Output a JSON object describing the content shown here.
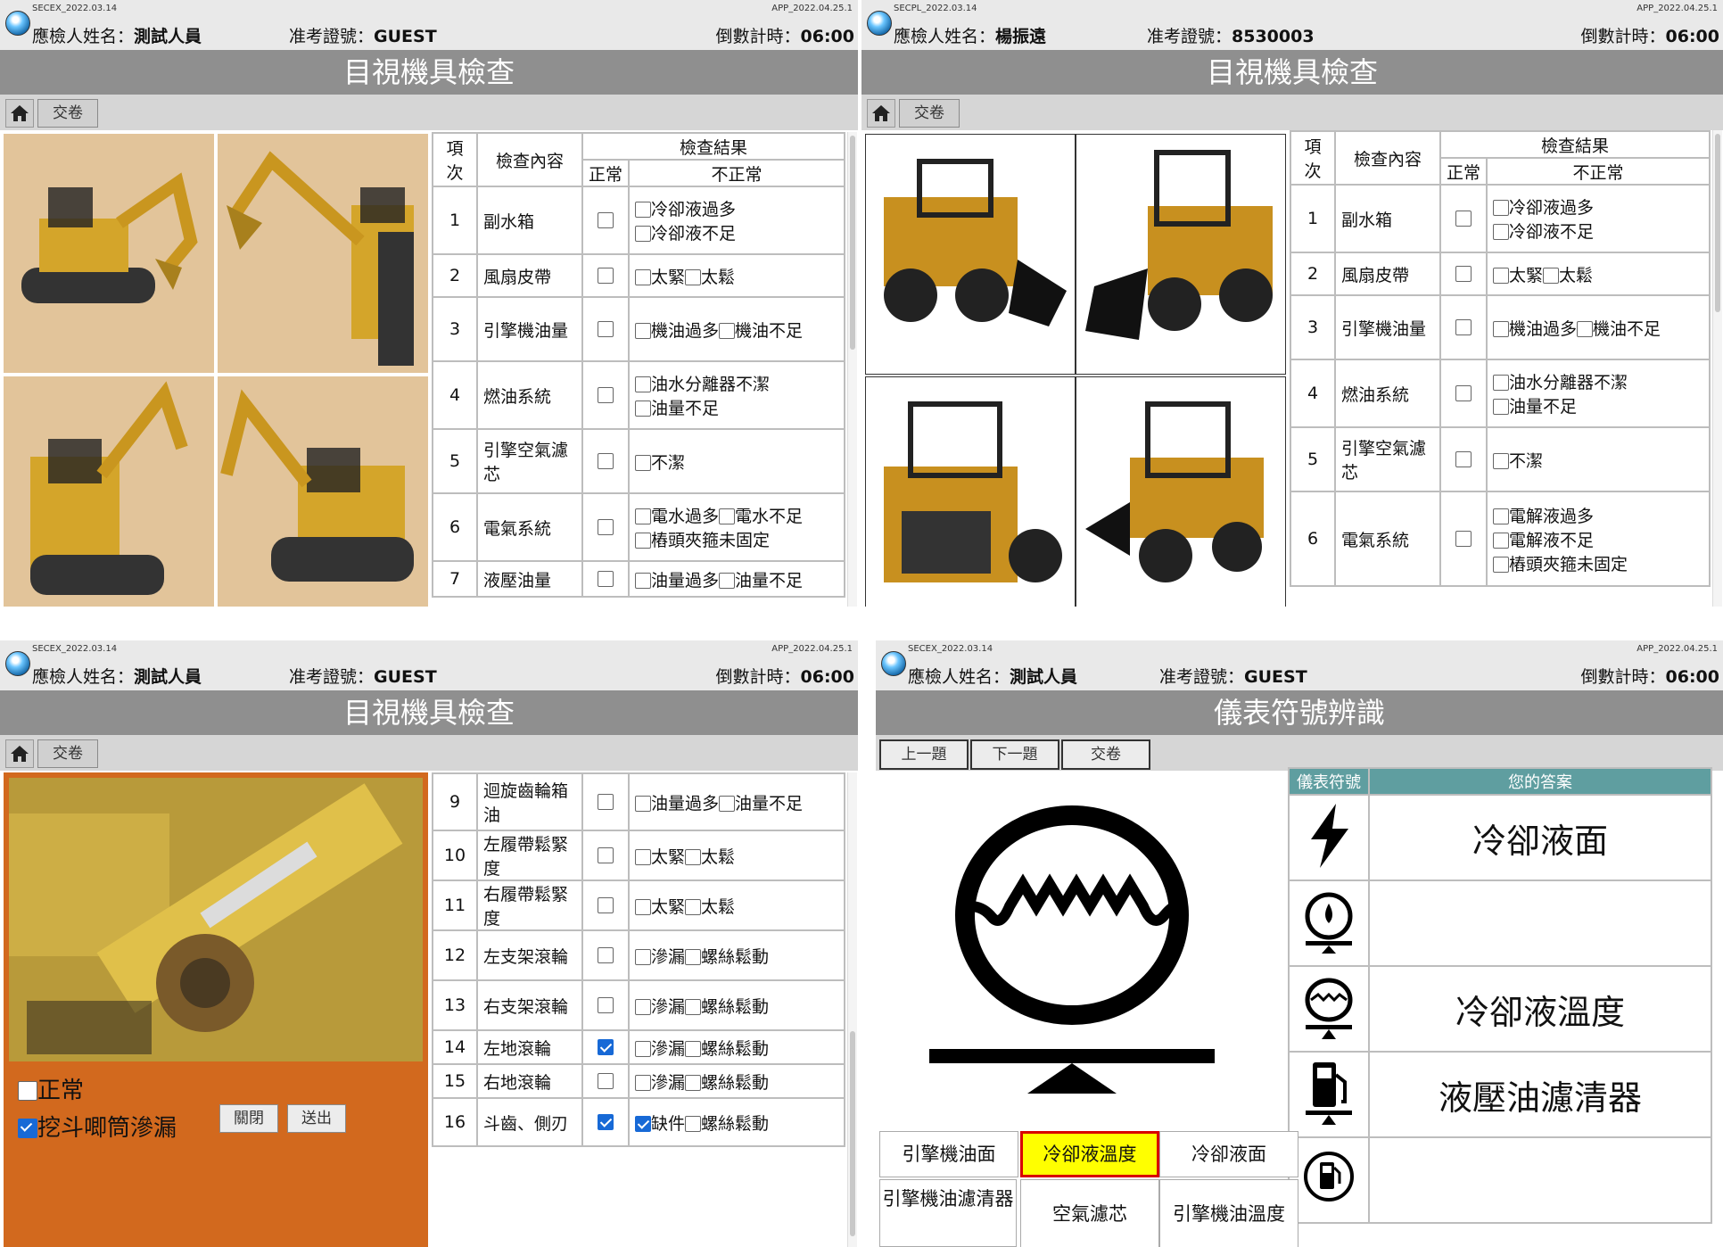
{
  "panels": {
    "excavator": {
      "version_left": "SECEX_2022.03.14",
      "version_right": "APP_2022.04.25.1",
      "name_label": "應檢人姓名：",
      "name_value": "測試人員",
      "id_label": "准考證號：",
      "id_value": "GUEST",
      "timer_label": "倒數計時：",
      "timer_value": "06:00",
      "title": "目視機具檢查",
      "submit_label": "交卷",
      "columns": {
        "no": "項次",
        "content": "檢查內容",
        "result": "檢查結果",
        "normal": "正常",
        "abnormal": "不正常"
      },
      "rows": [
        {
          "no": "1",
          "item": "副水箱",
          "options": [
            "冷卻液過多",
            "冷卻液不足"
          ]
        },
        {
          "no": "2",
          "item": "風扇皮帶",
          "options": [
            "太緊",
            "太鬆"
          ]
        },
        {
          "no": "3",
          "item": "引擎機油量",
          "options": [
            "機油過多",
            "機油不足"
          ]
        },
        {
          "no": "4",
          "item": "燃油系統",
          "options": [
            "油水分離器不潔",
            "油量不足"
          ]
        },
        {
          "no": "5",
          "item": "引擎空氣濾芯",
          "options": [
            "不潔"
          ]
        },
        {
          "no": "6",
          "item": "電氣系統",
          "options": [
            "電水過多",
            "電水不足",
            "樁頭夾箍未固定"
          ]
        },
        {
          "no": "7",
          "item": "液壓油量",
          "options": [
            "油量過多",
            "油量不足"
          ]
        }
      ]
    },
    "loader": {
      "version_left": "SECPL_2022.03.14",
      "version_right": "APP_2022.04.25.1",
      "name_label": "應檢人姓名：",
      "name_value": "楊振遠",
      "id_label": "准考證號：",
      "id_value": "8530003",
      "timer_label": "倒數計時：",
      "timer_value": "06:00",
      "title": "目視機具檢查",
      "submit_label": "交卷",
      "columns": {
        "no": "項次",
        "content": "檢查內容",
        "result": "檢查結果",
        "normal": "正常",
        "abnormal": "不正常"
      },
      "rows": [
        {
          "no": "1",
          "item": "副水箱",
          "options": [
            "冷卻液過多",
            "冷卻液不足"
          ]
        },
        {
          "no": "2",
          "item": "風扇皮帶",
          "options": [
            "太緊",
            "太鬆"
          ]
        },
        {
          "no": "3",
          "item": "引擎機油量",
          "options": [
            "機油過多",
            "機油不足"
          ]
        },
        {
          "no": "4",
          "item": "燃油系統",
          "options": [
            "油水分離器不潔",
            "油量不足"
          ]
        },
        {
          "no": "5",
          "item": "引擎空氣濾芯",
          "options": [
            "不潔"
          ]
        },
        {
          "no": "6",
          "item": "電氣系統",
          "options": [
            "電解液過多",
            "電解液不足",
            "樁頭夾箍未固定"
          ]
        }
      ]
    },
    "detail": {
      "version_left": "SECEX_2022.03.14",
      "version_right": "APP_2022.04.25.1",
      "name_label": "應檢人姓名：",
      "name_value": "測試人員",
      "id_label": "准考證號：",
      "id_value": "GUEST",
      "timer_label": "倒數計時：",
      "timer_value": "06:00",
      "title": "目視機具檢查",
      "submit_label": "交卷",
      "normal_label": "正常",
      "defect_label": "挖斗唧筒滲漏",
      "close_label": "關閉",
      "send_label": "送出",
      "rows": [
        {
          "no": "9",
          "item": "迴旋齒輪箱油",
          "checked": false,
          "options": [
            "油量過多",
            "油量不足"
          ],
          "opt_checked": [
            false,
            false
          ]
        },
        {
          "no": "10",
          "item": "左履帶鬆緊度",
          "checked": false,
          "options": [
            "太緊",
            "太鬆"
          ],
          "opt_checked": [
            false,
            false
          ]
        },
        {
          "no": "11",
          "item": "右履帶鬆緊度",
          "checked": false,
          "options": [
            "太緊",
            "太鬆"
          ],
          "opt_checked": [
            false,
            false
          ]
        },
        {
          "no": "12",
          "item": "左支架滾輪",
          "checked": false,
          "options": [
            "滲漏",
            "螺絲鬆動"
          ],
          "opt_checked": [
            false,
            false
          ]
        },
        {
          "no": "13",
          "item": "右支架滾輪",
          "checked": false,
          "options": [
            "滲漏",
            "螺絲鬆動"
          ],
          "opt_checked": [
            false,
            false
          ]
        },
        {
          "no": "14",
          "item": "左地滾輪",
          "checked": true,
          "options": [
            "滲漏",
            "螺絲鬆動"
          ],
          "opt_checked": [
            false,
            false
          ]
        },
        {
          "no": "15",
          "item": "右地滾輪",
          "checked": false,
          "options": [
            "滲漏",
            "螺絲鬆動"
          ],
          "opt_checked": [
            false,
            false
          ]
        },
        {
          "no": "16",
          "item": "斗齒、側刃",
          "checked": true,
          "options": [
            "缺件",
            "螺絲鬆動"
          ],
          "opt_checked": [
            true,
            false
          ]
        }
      ]
    },
    "gauge": {
      "version_left": "SECEX_2022.03.14",
      "version_right": "APP_2022.04.25.1",
      "name_label": "應檢人姓名：",
      "name_value": "測試人員",
      "id_label": "准考證號：",
      "id_value": "GUEST",
      "timer_label": "倒數計時：",
      "timer_value": "06:00",
      "title": "儀表符號辨識",
      "prev_label": "上一題",
      "next_label": "下一題",
      "submit_label": "交卷",
      "col_symbol": "儀表符號",
      "col_answer": "您的答案",
      "answers": [
        {
          "icon": "lightning-icon",
          "answer": "冷卻液面"
        },
        {
          "icon": "oil-pressure-icon",
          "answer": ""
        },
        {
          "icon": "coolant-temp-icon",
          "answer": "冷卻液溫度"
        },
        {
          "icon": "fuel-pump-icon",
          "answer": "液壓油濾清器"
        },
        {
          "icon": "fuel-gauge-icon",
          "answer": ""
        }
      ],
      "choices": [
        "引擎機油面",
        "冷卻液溫度",
        "冷卻液面",
        "引擎機油濾清器",
        "空氣濾芯",
        "引擎機油溫度"
      ],
      "selected_choice": "冷卻液溫度"
    }
  },
  "colors": {
    "detail_bg": "#d2691e",
    "photo_bg": "#e2c49a",
    "gauge_header": "#5f9ea0",
    "selected": "#ffff00"
  }
}
